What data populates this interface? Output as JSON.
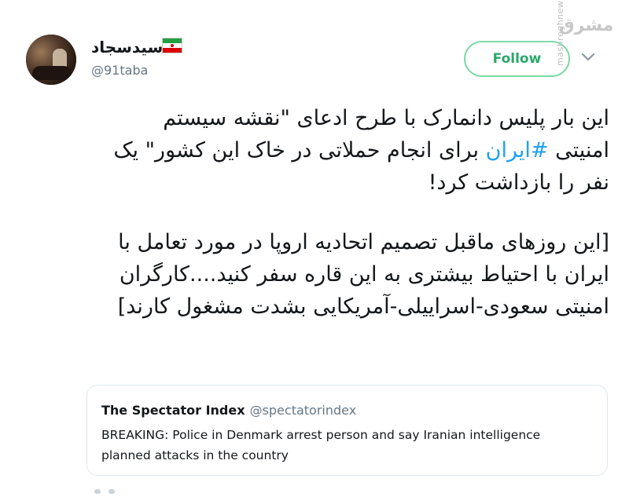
{
  "user": {
    "display_name": "سیدسجاد",
    "handle": "@91taba",
    "flag": "iran-flag-icon"
  },
  "follow": {
    "label": "Follow"
  },
  "watermark": {
    "logo_text": "مشرق",
    "url": "mashreghnews.ir"
  },
  "tweet": {
    "paragraph1": {
      "before": "این بار پلیس دانمارک با طرح ادعای \"نقشه سیستم امنیتی ",
      "hashtag": "#ایران",
      "after": " برای انجام حملاتی در خاک این کشور\" یک نفر را بازداشت کرد!"
    },
    "paragraph2": "[این روزهای ماقبل تصمیم اتحادیه اروپا در مورد تعامل با ایران با احتیاط بیشتری به این قاره سفر کنید....کارگران امنیتی سعودی-اسراییلی-آمریکایی بشدت مشغول کارند]"
  },
  "quoted": {
    "name": "The Spectator Index",
    "handle": "@spectatorindex",
    "text": "BREAKING: Police in Denmark arrest person and say Iranian intelligence planned attacks in the country"
  },
  "colors": {
    "follow": "#2aa86b",
    "hashtag": "#1da1f2",
    "muted": "#657786"
  }
}
